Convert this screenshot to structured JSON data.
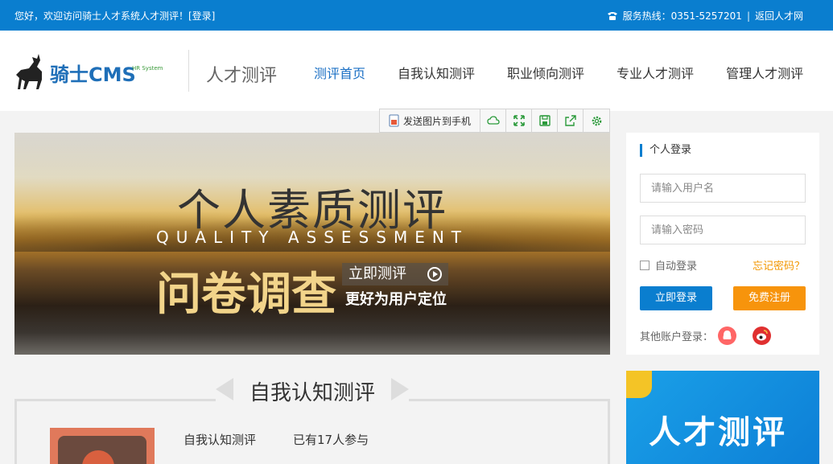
{
  "topbar": {
    "welcome": "您好，欢迎访问骑士人才系统人才测评！[登录]",
    "hotline": "服务热线：0351-5257201",
    "separator": "|",
    "back_link": "返回人才网"
  },
  "header": {
    "logo_text": "骑士CMS",
    "logo_sub": "HR System",
    "site_title": "人才测评",
    "nav": [
      "测评首页",
      "自我认知测评",
      "职业倾向测评",
      "专业人才测评",
      "管理人才测评"
    ]
  },
  "toolbar": {
    "send_label": "发送图片到手机",
    "icons": [
      "cloud-icon",
      "expand-icon",
      "save-icon",
      "share-icon",
      "settings-icon"
    ]
  },
  "banner": {
    "title": "个人素质测评",
    "subtitle": "QUALITY ASSESSMENT",
    "big_text": "问卷调查",
    "button": "立即测评",
    "slogan": "更好为用户定位"
  },
  "login": {
    "title": "个人登录",
    "username_placeholder": "请输入用户名",
    "password_placeholder": "请输入密码",
    "auto_login": "自动登录",
    "forgot": "忘记密码？",
    "login_button": "立即登录",
    "register_button": "免费注册",
    "other_accounts": "其他账户登录："
  },
  "section": {
    "title": "自我认知测评",
    "item_name": "自我认知测评",
    "item_count": "已有17人参与"
  },
  "promo": {
    "title": "人才测评"
  },
  "colors": {
    "primary": "#0a7ecf",
    "accent": "#f7940c",
    "nav_active": "#1a6fc4"
  }
}
